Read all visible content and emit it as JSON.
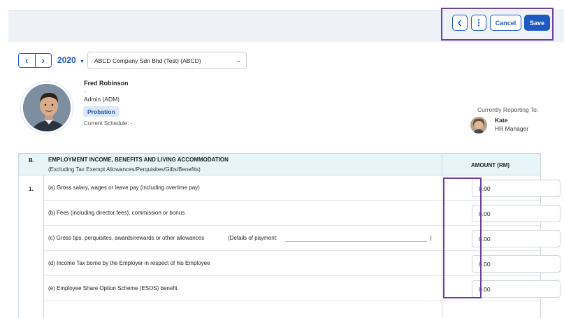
{
  "toolbar": {
    "back_icon": "chevron-left-icon",
    "more_icon": "vertical-dots-icon",
    "cancel_label": "Cancel",
    "save_label": "Save"
  },
  "period": {
    "year": "2020",
    "company": "ABCD Company Sdn Bhd (Test) (ABCD)"
  },
  "employee": {
    "name": "Fred Robinson",
    "dash": "-",
    "role": "Admin (ADM)",
    "status": "Probation",
    "schedule": "Current Schedule: -"
  },
  "reporting": {
    "label": "Currently Reporting To:",
    "name": "Kate",
    "role": "HR Manager"
  },
  "section": {
    "letter": "B.",
    "title": "EMPLOYMENT INCOME, BENEFITS AND LIVING ACCOMMODATION",
    "subtitle": "(Excluding Tax Exempt Allowances/Perquisites/Gifts/Benefits)",
    "amount_header": "AMOUNT (RM)",
    "row_number": "1.",
    "rows": [
      {
        "label": "(a)  Gross salary, wages or leave pay (including overtime pay)",
        "amount": "0.00"
      },
      {
        "label": "(b)  Fees (including director fees), commission or bonus",
        "amount": "0.00"
      },
      {
        "label": "(c)  Gross tips, perquisites, awards/rewards or other allowances",
        "extra": "(Details of payment:",
        "paren": ")",
        "amount": "0.00"
      },
      {
        "label": "(d)  Income Tax borne by the Employer in respect of his Employee",
        "amount": "0.00"
      },
      {
        "label": "(e)  Employee Share Option Scheme (ESOS) benefit",
        "amount": "0.00"
      }
    ]
  },
  "colors": {
    "primary": "#1f57c3",
    "highlight": "#6b3fa0",
    "header_bg": "#e8f5f8",
    "badge_bg": "#dde7f7"
  }
}
